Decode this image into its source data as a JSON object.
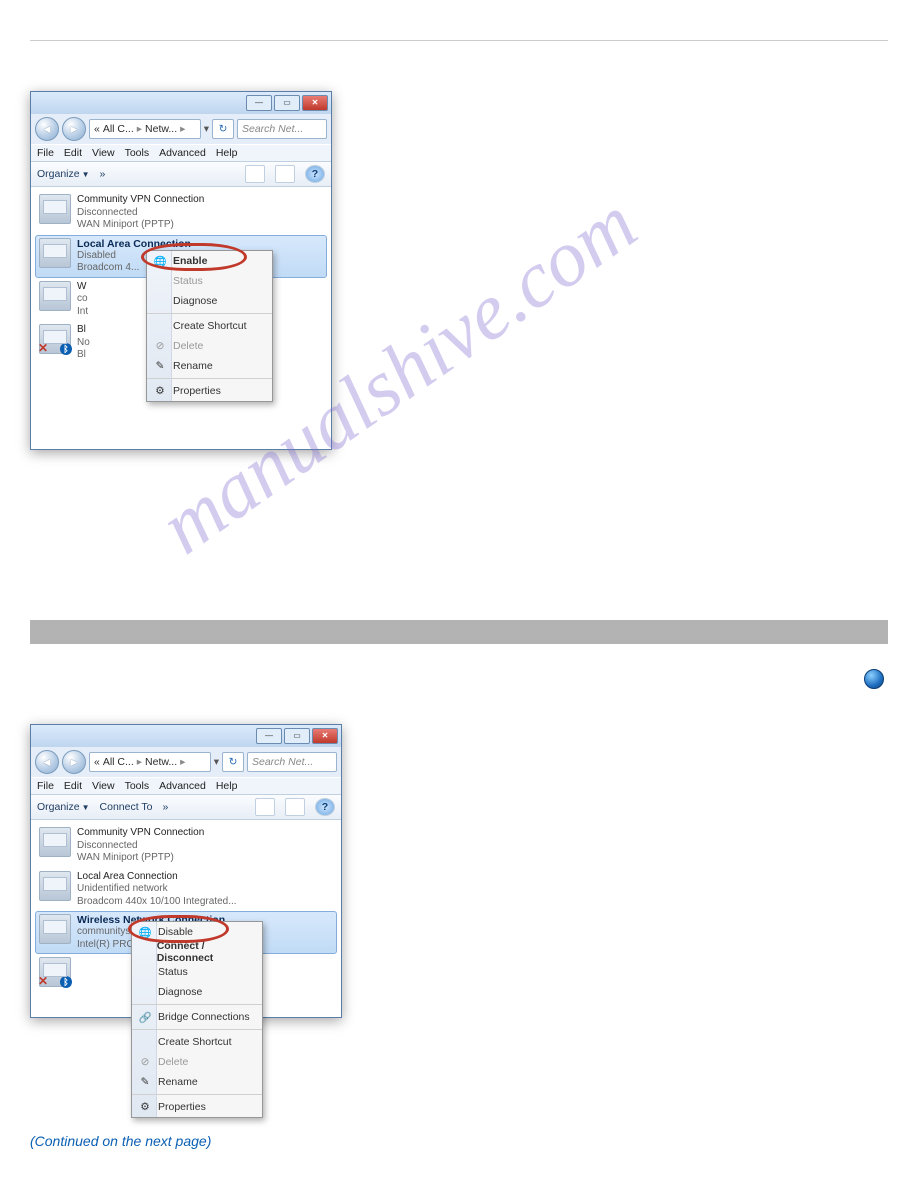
{
  "watermark": "manualshive.com",
  "win1": {
    "addr": {
      "p1": "All C...",
      "p2": "Netw...",
      "sep": "▸"
    },
    "search_placeholder": "Search Net...",
    "menubar": [
      "File",
      "Edit",
      "View",
      "Tools",
      "Advanced",
      "Help"
    ],
    "toolbar": {
      "organize": "Organize",
      "more": "»"
    },
    "entries": [
      {
        "name": "Community VPN Connection",
        "l1": "Disconnected",
        "l2": "WAN Miniport (PPTP)"
      },
      {
        "name": "Local Area Connection",
        "l1": "Disabled",
        "l2": "Broadcom 4..."
      },
      {
        "name_prefix": "W",
        "l1_prefix": "co",
        "l2_prefix": "Int"
      },
      {
        "name_prefix": "Bl",
        "l1_prefix": "No",
        "l2_prefix": "Bl"
      }
    ],
    "ctx": {
      "enable": "Enable",
      "status": "Status",
      "diagnose": "Diagnose",
      "create_shortcut": "Create Shortcut",
      "delete": "Delete",
      "rename": "Rename",
      "properties": "Properties"
    }
  },
  "win2": {
    "addr": {
      "p1": "All C...",
      "p2": "Netw...",
      "sep": "▸"
    },
    "search_placeholder": "Search Net...",
    "menubar": [
      "File",
      "Edit",
      "View",
      "Tools",
      "Advanced",
      "Help"
    ],
    "toolbar": {
      "organize": "Organize",
      "connect": "Connect To",
      "more": "»"
    },
    "entries": [
      {
        "name": "Community VPN Connection",
        "l1": "Disconnected",
        "l2": "WAN Miniport (PPTP)"
      },
      {
        "name": "Local Area Connection",
        "l1": "Unidentified network",
        "l2": "Broadcom 440x 10/100 Integrated..."
      },
      {
        "name": "Wireless Network Connection",
        "l1": "communityspeakers.net",
        "l2": "Intel(R) PRO/Wireless 3945ABG N..."
      }
    ],
    "ctx": {
      "disable": "Disable",
      "connect": "Connect / Disconnect",
      "status": "Status",
      "diagnose": "Diagnose",
      "bridge": "Bridge Connections",
      "create_shortcut": "Create Shortcut",
      "delete": "Delete",
      "rename": "Rename",
      "properties": "Properties"
    }
  },
  "page": {
    "footer_label": "(Continued on the next page)"
  }
}
